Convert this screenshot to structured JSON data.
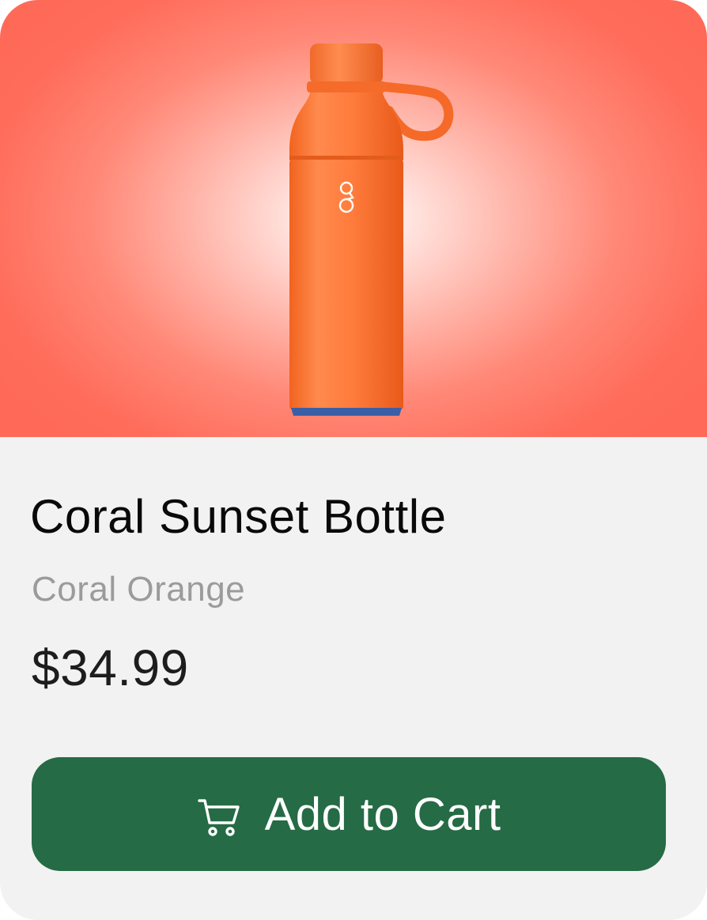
{
  "product": {
    "name": "Coral Sunset Bottle",
    "variant": "Coral Orange",
    "price": "$34.99",
    "image_alt": "Orange reusable water bottle with loop cap"
  },
  "actions": {
    "add_to_cart_label": "Add to Cart",
    "add_to_cart_icon": "cart-icon"
  },
  "colors": {
    "hero_background": "#ff6a58",
    "bottle": "#ff7a3c",
    "card_background": "#f2f2f2",
    "button_background": "#256b45",
    "button_text": "#ffffff",
    "variant_text": "#9b9b9b"
  }
}
